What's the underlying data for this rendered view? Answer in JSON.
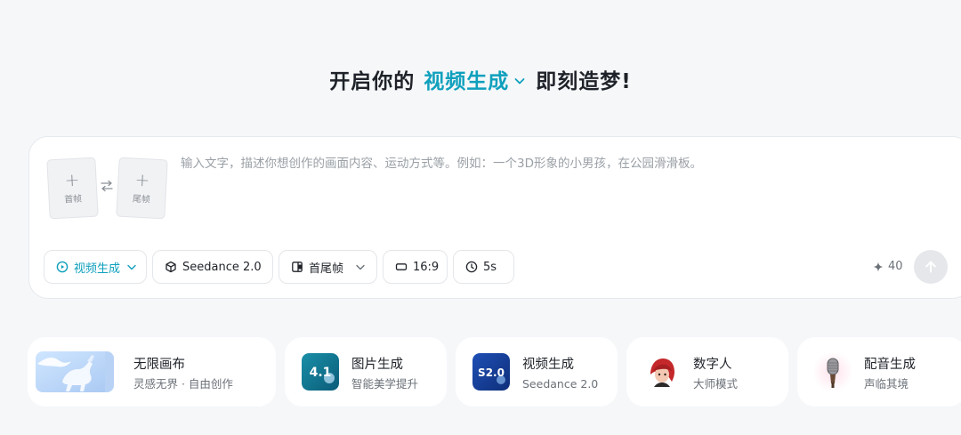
{
  "hero": {
    "prefix": "开启你的",
    "mode": "视频生成",
    "suffix": "即刻造梦!"
  },
  "composer": {
    "first_frame_label": "首帧",
    "last_frame_label": "尾帧",
    "prompt_placeholder": "输入文字，描述你想创作的画面内容、运动方式等。例如：一个3D形象的小男孩，在公园滑滑板。",
    "prompt_value": ""
  },
  "toolbar": {
    "mode_label": "视频生成",
    "model_label": "Seedance 2.0",
    "frames_label": "首尾帧",
    "ratio_label": "16:9",
    "duration_label": "5s",
    "credits": "40"
  },
  "colors": {
    "accent": "#0fa0bd",
    "background": "#f5f7f9",
    "send_button": "#e5e7ea"
  },
  "cards": [
    {
      "title": "无限画布",
      "subtitle": "灵感无界 · 自由创作",
      "icon": "pegasus-thumbnail"
    },
    {
      "title": "图片生成",
      "subtitle": "智能美学提升",
      "icon": "image-4.1-logo",
      "badge": "4.1"
    },
    {
      "title": "视频生成",
      "subtitle": "Seedance 2.0",
      "icon": "seedance-2.0-logo",
      "badge": "S2.0"
    },
    {
      "title": "数字人",
      "subtitle": "大师模式",
      "icon": "avatar-girl-icon"
    },
    {
      "title": "配音生成",
      "subtitle": "声临其境",
      "icon": "microphone-icon"
    }
  ]
}
